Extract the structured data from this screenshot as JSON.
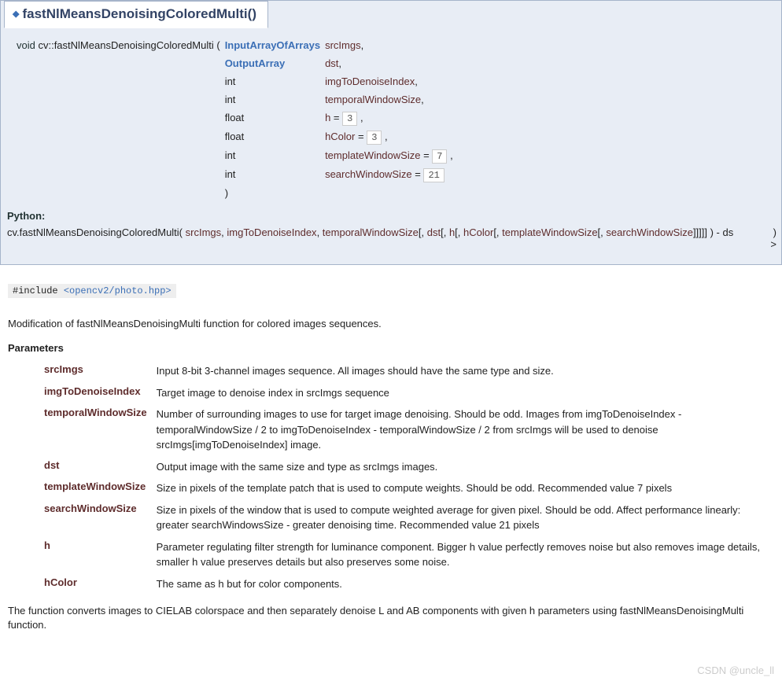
{
  "title": "fastNlMeansDenoisingColoredMulti()",
  "signature": {
    "ret": "void",
    "qual": "cv::fastNlMeansDenoisingColoredMulti",
    "open": "(",
    "close": ")",
    "rows": [
      {
        "type": "InputArrayOfArrays",
        "type_link": true,
        "name": "srcImgs",
        "tail": ","
      },
      {
        "type": "OutputArray",
        "type_link": true,
        "name": "dst",
        "tail": ","
      },
      {
        "type": "int",
        "type_link": false,
        "name": "imgToDenoiseIndex",
        "tail": ","
      },
      {
        "type": "int",
        "type_link": false,
        "name": "temporalWindowSize",
        "tail": ","
      },
      {
        "type": "float",
        "type_link": false,
        "name": "h",
        "eq": " = ",
        "default": "3",
        "tail": " ,"
      },
      {
        "type": "float",
        "type_link": false,
        "name": "hColor",
        "eq": " = ",
        "default": "3",
        "tail": " ,"
      },
      {
        "type": "int",
        "type_link": false,
        "name": "templateWindowSize",
        "eq": " = ",
        "default": "7",
        "tail": " ,"
      },
      {
        "type": "int",
        "type_link": false,
        "name": "searchWindowSize",
        "eq": " = ",
        "default": "21",
        "tail": ""
      }
    ]
  },
  "python": {
    "label": "Python:",
    "prefix": "cv.fastNlMeansDenoisingColoredMulti(",
    "p1": "srcImgs",
    "c1": ", ",
    "p2": "imgToDenoiseIndex",
    "c2": ", ",
    "p3": "temporalWindowSize",
    "o_open": "[, ",
    "p4": "dst",
    "o2": "[, ",
    "p5": "h",
    "o3": "[, ",
    "p6": "hColor",
    "o4": "[, ",
    "p7": "templateWindowSize",
    "o5": "[, ",
    "p8": "searchWindowSize",
    "o_close": "]]]]]",
    "after_paren": " ) -  ds",
    "right_top": ")",
    "right_bot": ">"
  },
  "include": {
    "pre": "#include ",
    "path": "<opencv2/photo.hpp>"
  },
  "brief": "Modification of fastNlMeansDenoisingMulti function for colored images sequences.",
  "params_heading": "Parameters",
  "params": [
    {
      "name": "srcImgs",
      "desc": "Input 8-bit 3-channel images sequence. All images should have the same type and size."
    },
    {
      "name": "imgToDenoiseIndex",
      "desc": "Target image to denoise index in srcImgs sequence"
    },
    {
      "name": "temporalWindowSize",
      "desc": "Number of surrounding images to use for target image denoising. Should be odd. Images from imgToDenoiseIndex - temporalWindowSize / 2 to imgToDenoiseIndex - temporalWindowSize / 2 from srcImgs will be used to denoise srcImgs[imgToDenoiseIndex] image."
    },
    {
      "name": "dst",
      "desc": "Output image with the same size and type as srcImgs images."
    },
    {
      "name": "templateWindowSize",
      "desc": "Size in pixels of the template patch that is used to compute weights. Should be odd. Recommended value 7 pixels"
    },
    {
      "name": "searchWindowSize",
      "desc": "Size in pixels of the window that is used to compute weighted average for given pixel. Should be odd. Affect performance linearly: greater searchWindowsSize - greater denoising time. Recommended value 21 pixels"
    },
    {
      "name": "h",
      "desc": "Parameter regulating filter strength for luminance component. Bigger h value perfectly removes noise but also removes image details, smaller h value preserves details but also preserves some noise."
    },
    {
      "name": "hColor",
      "desc": "The same as h but for color components."
    }
  ],
  "tail_text": "The function converts images to CIELAB colorspace and then separately denoise L and AB components with given h parameters using fastNlMeansDenoisingMulti function.",
  "watermark": "CSDN @uncle_ll"
}
